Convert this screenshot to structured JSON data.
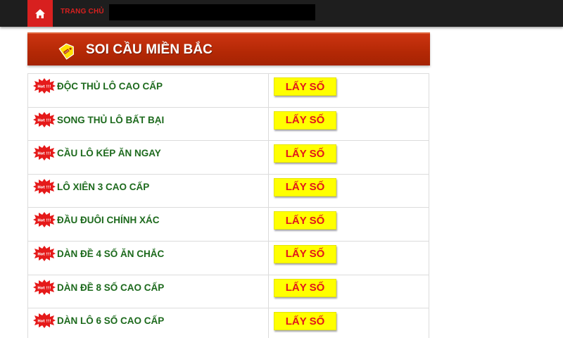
{
  "nav": {
    "home_icon": "home-icon",
    "link_label": "TRANG CHỦ"
  },
  "section": {
    "icon": "news-tag-icon",
    "title": "SOI CẦU MIỀN BẮC"
  },
  "hot_badge_text": "Hot !!!",
  "rows": [
    {
      "label": "ĐỘC THỦ LÔ CAO CẤP",
      "button": "LẤY SỐ"
    },
    {
      "label": "SONG THỦ LÔ BẤT BẠI",
      "button": "LẤY SỐ"
    },
    {
      "label": "CẦU LÔ KÉP ĂN NGAY",
      "button": "LẤY SỐ"
    },
    {
      "label": "LÔ XIÊN 3 CAO CẤP",
      "button": "LẤY SỐ"
    },
    {
      "label": "ĐẦU ĐUÔI CHÍNH XÁC",
      "button": "LẤY SỐ"
    },
    {
      "label": "DÀN ĐỀ 4 SỐ ĂN CHẮC",
      "button": "LẤY SỐ"
    },
    {
      "label": "DÀN ĐỀ 8 SỐ CAO CẤP",
      "button": "LẤY SỐ"
    },
    {
      "label": "DÀN LÔ 6 SỐ CAO CẤP",
      "button": "LẤY SỐ"
    }
  ],
  "colors": {
    "topbar": "#1e1e1e",
    "accent_red": "#d8201f",
    "header_red": "#b32805",
    "label_green": "#1d6a1d",
    "button_yellow": "#ffff00",
    "button_text": "#e2141c"
  }
}
